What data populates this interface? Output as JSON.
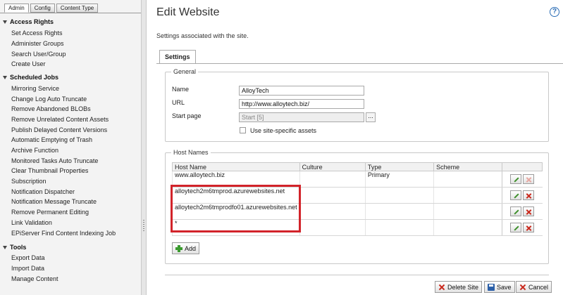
{
  "left_tabs": [
    "Admin",
    "Config",
    "Content Type"
  ],
  "sections": [
    {
      "title": "Access Rights",
      "items": [
        "Set Access Rights",
        "Administer Groups",
        "Search User/Group",
        "Create User"
      ]
    },
    {
      "title": "Scheduled Jobs",
      "items": [
        "Mirroring Service",
        "Change Log Auto Truncate",
        "Remove Abandoned BLOBs",
        "Remove Unrelated Content Assets",
        "Publish Delayed Content Versions",
        "Automatic Emptying of Trash",
        "Archive Function",
        "Monitored Tasks Auto Truncate",
        "Clear Thumbnail Properties",
        "Subscription",
        "Notification Dispatcher",
        "Notification Message Truncate",
        "Remove Permanent Editing",
        "Link Validation",
        "EPiServer Find Content Indexing Job"
      ]
    },
    {
      "title": "Tools",
      "items": [
        "Export Data",
        "Import Data",
        "Manage Content"
      ]
    }
  ],
  "main": {
    "title": "Edit Website",
    "help_icon": "?",
    "description": "Settings associated with the site.",
    "tab_label": "Settings"
  },
  "general": {
    "legend": "General",
    "name_label": "Name",
    "name_value": "AlloyTech",
    "url_label": "URL",
    "url_value": "http://www.alloytech.biz/",
    "start_label": "Start page",
    "start_value": "Start [5]",
    "browse_label": "...",
    "site_assets_label": "Use site-specific assets"
  },
  "hosts": {
    "legend": "Host Names",
    "columns": [
      "Host Name",
      "Culture",
      "Type",
      "Scheme"
    ],
    "rows": [
      {
        "host": "www.alloytech.biz",
        "culture": "",
        "type": "Primary",
        "scheme": ""
      },
      {
        "host": "alloytech2m6tmprod.azurewebsites.net",
        "culture": "",
        "type": "",
        "scheme": ""
      },
      {
        "host": "alloytech2m6tmprodfo01.azurewebsites.net",
        "culture": "",
        "type": "",
        "scheme": ""
      },
      {
        "host": "*",
        "culture": "",
        "type": "",
        "scheme": ""
      }
    ],
    "add_label": "Add"
  },
  "footer": {
    "delete_label": "Delete Site",
    "save_label": "Save",
    "cancel_label": "Cancel"
  },
  "colors": {
    "highlight_box": "#d2232a",
    "edit_icon": "#3d8f2a",
    "delete_icon": "#c9271b"
  }
}
